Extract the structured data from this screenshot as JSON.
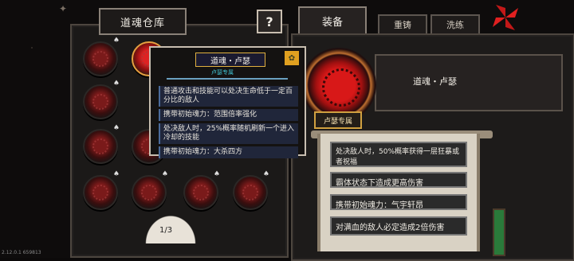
{
  "left": {
    "title": "道魂仓库",
    "help": "?",
    "page": "1/3"
  },
  "tabs": [
    "装备",
    "重铸",
    "洗练"
  ],
  "tooltip": {
    "title": "道魂・卢瑟",
    "subtitle": "卢瑟专属",
    "items": [
      "普通攻击和技能可以处决生命低于一定百分比的敌人",
      "携带初始魂力：范围倍率强化",
      "处决敌人时，25%概率随机刷新一个进入冷却的技能",
      "携带初始魂力：大杀四方"
    ]
  },
  "equip": {
    "name": "道魂・卢瑟",
    "owner": "卢瑟专属",
    "scroll_items": [
      "处决敌人时，50%概率获得一层狂暴或者祝福",
      "霸体状态下造成更高伤害",
      "携带初始魂力：气宇轩昂",
      "对满血的敌人必定造成2倍伤害"
    ]
  },
  "version": "2.12.0.1 659813",
  "colors": {
    "accent": "#e0a020",
    "orb": "#d22020",
    "scroll": "#d9d2c4"
  }
}
